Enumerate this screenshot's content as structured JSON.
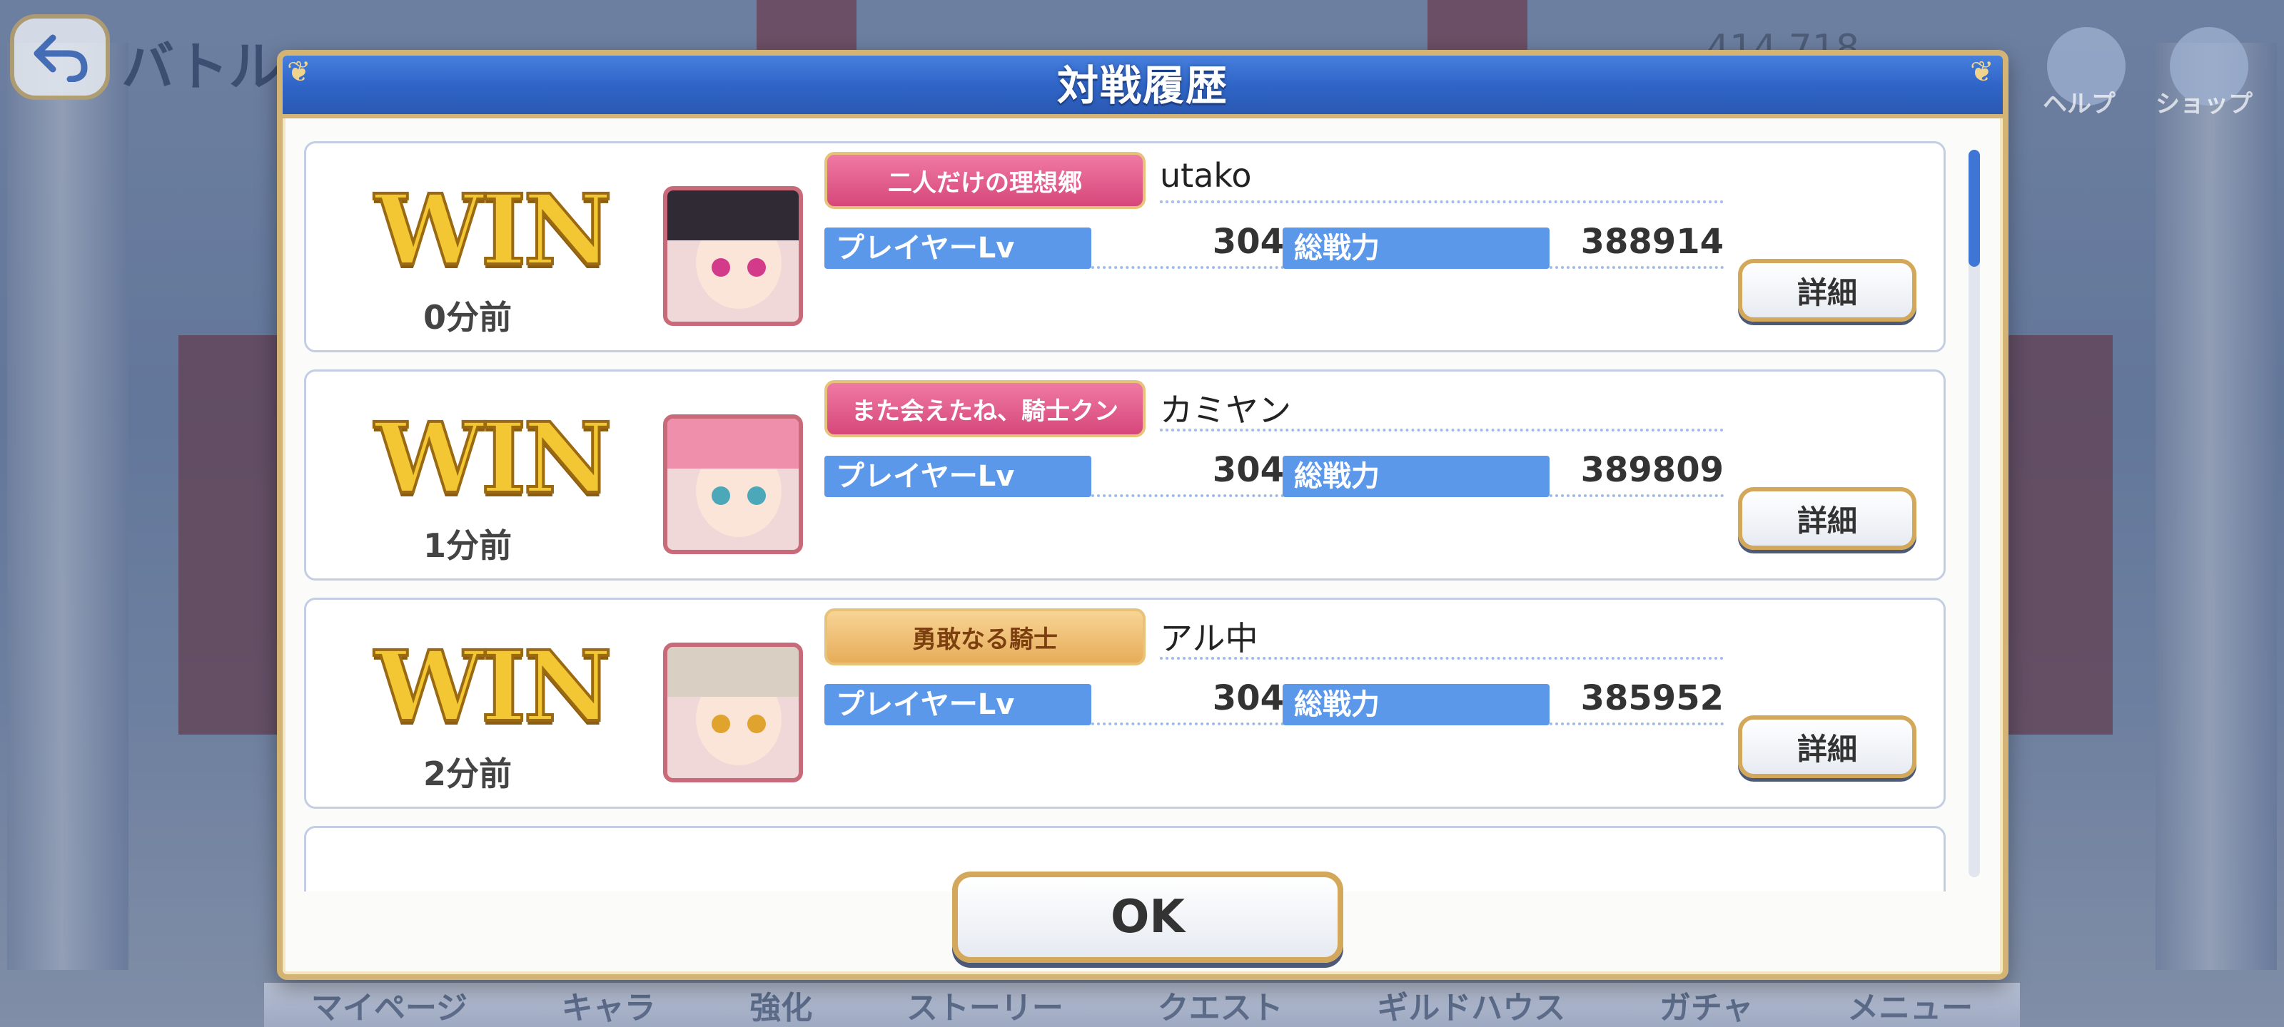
{
  "background": {
    "screen_title": "バトル",
    "coins": "414,718",
    "top_icons": [
      {
        "label": "ヘルプ",
        "icon": "help-icon"
      },
      {
        "label": "ショップ",
        "icon": "shop-icon"
      }
    ],
    "nav": [
      "マイページ",
      "キャラ",
      "強化",
      "ストーリー",
      "クエスト",
      "ギルドハウス",
      "ガチャ",
      "メニュー"
    ]
  },
  "dialog": {
    "title": "対戦履歴",
    "ok_label": "OK",
    "labels": {
      "win": "WIN",
      "player_lv": "プレイヤーLv",
      "power": "総戦力",
      "detail": "詳細"
    },
    "entries": [
      {
        "result": "WIN",
        "time_ago": "0分前",
        "emblem": "二人だけの理想郷",
        "name": "utako",
        "player_lv": "304",
        "power": "388914"
      },
      {
        "result": "WIN",
        "time_ago": "1分前",
        "emblem": "また会えたね、騎士クン",
        "name": "カミヤン",
        "player_lv": "304",
        "power": "389809"
      },
      {
        "result": "WIN",
        "time_ago": "2分前",
        "emblem": "勇敢なる騎士",
        "name": "アル中",
        "player_lv": "304",
        "power": "385952"
      }
    ]
  },
  "colors": {
    "header_blue": "#2f65c7",
    "label_blue": "#5b98ea",
    "gold_border": "#d3b474",
    "win_gold": "#f3c634"
  }
}
